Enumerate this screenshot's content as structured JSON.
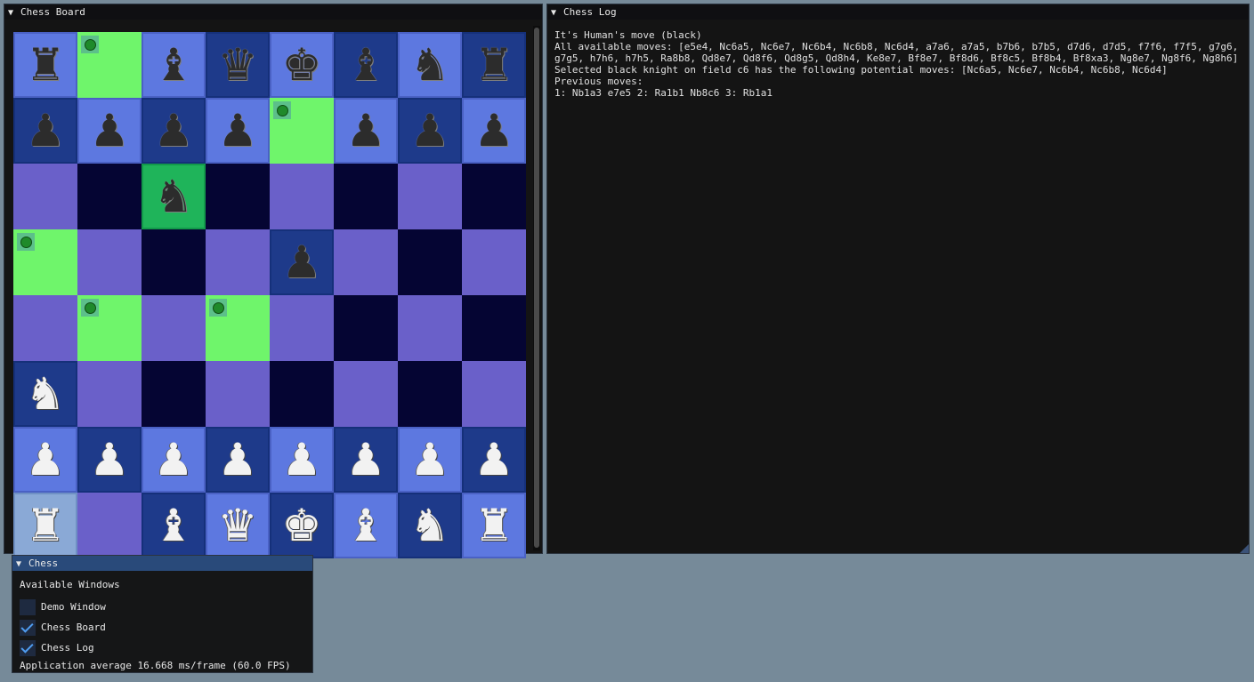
{
  "board_window": {
    "title": "Chess Board"
  },
  "log_window": {
    "title": "Chess Log",
    "lines": [
      "It's Human's move (black)",
      "All available moves: [e5e4, Nc6a5, Nc6e7, Nc6b4, Nc6b8, Nc6d4, a7a6, a7a5, b7b6, b7b5, d7d6, d7d5, f7f6, f7f5, g7g6, g7g5, h7h6, h7h5, Ra8b8, Qd8e7, Qd8f6, Qd8g5, Qd8h4, Ke8e7, Bf8e7, Bf8d6, Bf8c5, Bf8b4, Bf8xa3, Ng8e7, Ng8f6, Ng8h6]",
      "Selected black knight on field c6 has the following potential moves: [Nc6a5, Nc6e7, Nc6b4, Nc6b8, Nc6d4]",
      "Previous moves:",
      "1: Nb1a3 e7e5  2: Ra1b1 Nb8c6  3: Rb1a1"
    ]
  },
  "chess_window": {
    "title": "Chess",
    "section_label": "Available Windows",
    "options": [
      {
        "label": "Demo Window",
        "checked": false
      },
      {
        "label": "Chess Board",
        "checked": true
      },
      {
        "label": "Chess Log",
        "checked": true
      }
    ],
    "stats": "Application average 16.668 ms/frame (60.0 FPS)"
  },
  "board": {
    "ranks": [
      [
        {
          "p": "rook",
          "c": "black"
        },
        {
          "t": true
        },
        {
          "p": "bishop",
          "c": "black"
        },
        {
          "p": "queen",
          "c": "black"
        },
        {
          "p": "king",
          "c": "black"
        },
        {
          "p": "bishop",
          "c": "black"
        },
        {
          "p": "knight",
          "c": "black"
        },
        {
          "p": "rook",
          "c": "black"
        }
      ],
      [
        {
          "p": "pawn",
          "c": "black"
        },
        {
          "p": "pawn",
          "c": "black"
        },
        {
          "p": "pawn",
          "c": "black"
        },
        {
          "p": "pawn",
          "c": "black"
        },
        {
          "t": true
        },
        {
          "p": "pawn",
          "c": "black"
        },
        {
          "p": "pawn",
          "c": "black"
        },
        {
          "p": "pawn",
          "c": "black"
        }
      ],
      [
        {},
        {},
        {
          "p": "knight",
          "c": "black",
          "sel": true
        },
        {},
        {},
        {},
        {},
        {}
      ],
      [
        {
          "t": true
        },
        {},
        {},
        {},
        {
          "p": "pawn",
          "c": "black"
        },
        {},
        {},
        {}
      ],
      [
        {},
        {
          "t": true
        },
        {},
        {
          "t": true
        },
        {},
        {},
        {},
        {}
      ],
      [
        {
          "p": "knight",
          "c": "white"
        },
        {},
        {},
        {},
        {},
        {},
        {},
        {}
      ],
      [
        {
          "p": "pawn",
          "c": "white"
        },
        {
          "p": "pawn",
          "c": "white"
        },
        {
          "p": "pawn",
          "c": "white"
        },
        {
          "p": "pawn",
          "c": "white"
        },
        {
          "p": "pawn",
          "c": "white"
        },
        {
          "p": "pawn",
          "c": "white"
        },
        {
          "p": "pawn",
          "c": "white"
        },
        {
          "p": "pawn",
          "c": "white"
        }
      ],
      [
        {
          "p": "rook",
          "c": "white",
          "last": true
        },
        {},
        {
          "p": "bishop",
          "c": "white"
        },
        {
          "p": "queen",
          "c": "white"
        },
        {
          "p": "king",
          "c": "white"
        },
        {
          "p": "bishop",
          "c": "white"
        },
        {
          "p": "knight",
          "c": "white"
        },
        {
          "p": "rook",
          "c": "white"
        }
      ]
    ]
  }
}
